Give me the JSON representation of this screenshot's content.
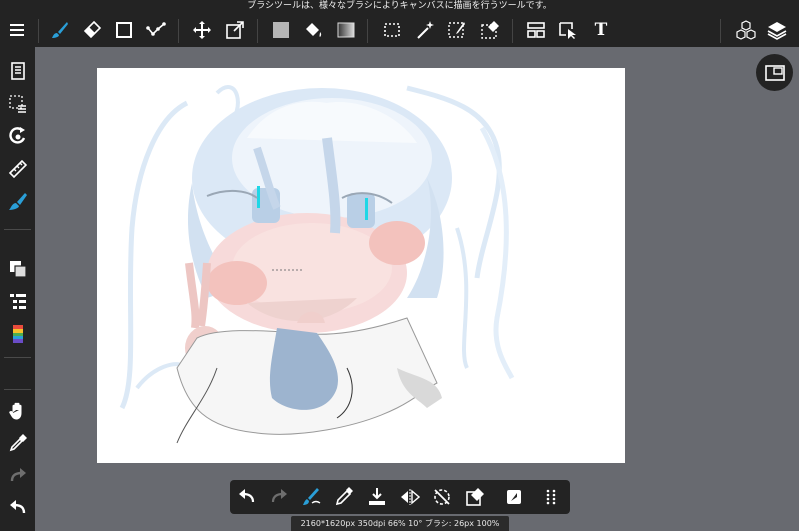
{
  "tooltip": "ブラシツールは、様々なブラシによりキャンバスに描画を行うツールです。",
  "status_bar": "2160*1620px 350dpi 66% 10° ブラシ: 26px 100%",
  "colors": {
    "accent": "#2a9fd8",
    "toolbar_bg": "#232323",
    "workspace_bg": "#686a70",
    "canvas_bg": "#ffffff"
  },
  "top_toolbar": [
    {
      "icon": "menu-icon"
    },
    {
      "icon": "brush-icon",
      "active": true
    },
    {
      "icon": "eraser-icon"
    },
    {
      "icon": "shape-rect-icon"
    },
    {
      "icon": "polyline-icon"
    },
    {
      "icon": "move-icon"
    },
    {
      "icon": "transform-icon"
    },
    {
      "icon": "fill-color-swatch-icon"
    },
    {
      "icon": "bucket-icon"
    },
    {
      "icon": "gradient-icon"
    },
    {
      "icon": "select-rect-icon"
    },
    {
      "icon": "magic-wand-icon"
    },
    {
      "icon": "select-pen-icon"
    },
    {
      "icon": "select-eraser-icon"
    },
    {
      "icon": "frame-divide-icon"
    },
    {
      "icon": "operation-icon"
    },
    {
      "icon": "text-icon",
      "label": "T"
    },
    {
      "icon": "3d-cubes-icon"
    },
    {
      "icon": "layers-icon"
    }
  ],
  "left_sidebar": [
    {
      "icon": "page-list-icon"
    },
    {
      "icon": "selection-menu-icon"
    },
    {
      "icon": "rotate-view-icon"
    },
    {
      "icon": "ruler-icon"
    },
    {
      "icon": "brush-settings-icon",
      "active": true
    },
    {
      "icon": "color-swatch-icon"
    },
    {
      "icon": "layer-list-icon"
    },
    {
      "icon": "color-palette-icon"
    },
    {
      "icon": "hand-icon"
    },
    {
      "icon": "eyedropper-icon"
    },
    {
      "icon": "redo-icon"
    },
    {
      "icon": "undo-icon"
    }
  ],
  "bottom_toolbar": [
    {
      "icon": "undo-icon"
    },
    {
      "icon": "redo-icon"
    },
    {
      "icon": "stabilizer-icon"
    },
    {
      "icon": "pen-icon"
    },
    {
      "icon": "import-icon"
    },
    {
      "icon": "flip-icon"
    },
    {
      "icon": "snap-off-icon"
    },
    {
      "icon": "clear-icon"
    },
    {
      "icon": "material-icon"
    },
    {
      "icon": "more-icon"
    }
  ]
}
